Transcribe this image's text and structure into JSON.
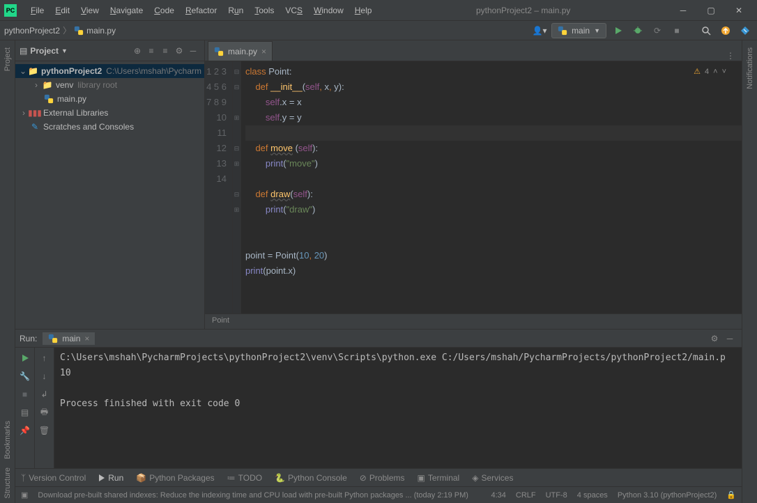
{
  "window_title": "pythonProject2 – main.py",
  "menu": [
    "File",
    "Edit",
    "View",
    "Navigate",
    "Code",
    "Refactor",
    "Run",
    "Tools",
    "VCS",
    "Window",
    "Help"
  ],
  "breadcrumb": {
    "project": "pythonProject2",
    "file": "main.py"
  },
  "run_config": "main",
  "project_panel": {
    "title": "Project",
    "root": {
      "name": "pythonProject2",
      "path": "C:\\Users\\mshah\\Pycharm"
    },
    "venv": {
      "name": "venv",
      "tag": "library root"
    },
    "file": "main.py",
    "ext_lib": "External Libraries",
    "scratches": "Scratches and Consoles"
  },
  "editor": {
    "tab": "main.py",
    "lines": [
      "1",
      "2",
      "3",
      "4",
      "5",
      "6",
      "7",
      "8",
      "9",
      "10",
      "11",
      "12",
      "13",
      "14"
    ],
    "warning_count": "4",
    "crumb": "Point"
  },
  "run": {
    "label": "Run:",
    "tab": "main",
    "console": "C:\\Users\\mshah\\PycharmProjects\\pythonProject2\\venv\\Scripts\\python.exe C:/Users/mshah/PycharmProjects/pythonProject2/main.p\n10\n\nProcess finished with exit code 0"
  },
  "bottom_tabs": {
    "vc": "Version Control",
    "run": "Run",
    "pkg": "Python Packages",
    "todo": "TODO",
    "pycon": "Python Console",
    "problems": "Problems",
    "terminal": "Terminal",
    "services": "Services"
  },
  "status": {
    "msg": "Download pre-built shared indexes: Reduce the indexing time and CPU load with pre-built Python packages ... (today 2:19 PM)",
    "pos": "4:34",
    "eol": "CRLF",
    "enc": "UTF-8",
    "indent": "4 spaces",
    "interp": "Python 3.10 (pythonProject2)"
  },
  "side_labels": {
    "project": "Project",
    "bookmarks": "Bookmarks",
    "structure": "Structure",
    "notifications": "Notifications"
  }
}
